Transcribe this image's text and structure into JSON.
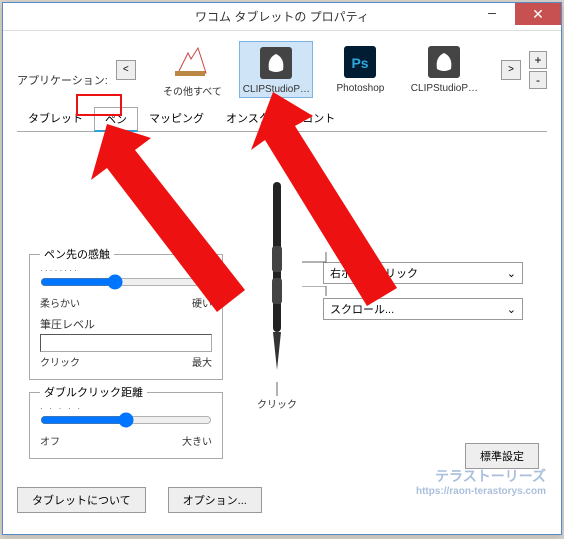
{
  "window": {
    "title": "ワコム タブレットの プロパティ"
  },
  "appRow": {
    "label": "アプリケーション:",
    "prev": "<",
    "next": ">",
    "add": "+",
    "remove": "-",
    "apps": [
      {
        "id": "all",
        "label": "その他すべて"
      },
      {
        "id": "csp",
        "label": "CLIPStudioP…"
      },
      {
        "id": "ps",
        "label": "Photoshop"
      },
      {
        "id": "csp2",
        "label": "CLIPStudioP…"
      }
    ],
    "selected": "csp"
  },
  "tabs": {
    "items": [
      "タブレット",
      "ペン",
      "マッピング",
      "オンスクリーンコント"
    ],
    "active": 1
  },
  "pen": {
    "tipFeel": {
      "title": "ペン先の感触",
      "soft": "柔らかい",
      "firm": "硬い",
      "pressure": "筆圧レベル",
      "click": "クリック",
      "max": "最大"
    },
    "doubleClick": {
      "title": "ダブルクリック距離",
      "off": "オフ",
      "large": "大きい"
    },
    "click": "クリック",
    "drop1": "右ボタンクリック",
    "drop2": "スクロール...",
    "defaults": "標準設定",
    "chev": "⌄"
  },
  "footer": {
    "about": "タブレットについて",
    "options": "オプション..."
  },
  "watermark": {
    "brand": "テラストーリーズ",
    "url": "https://raon-terastorys.com"
  }
}
